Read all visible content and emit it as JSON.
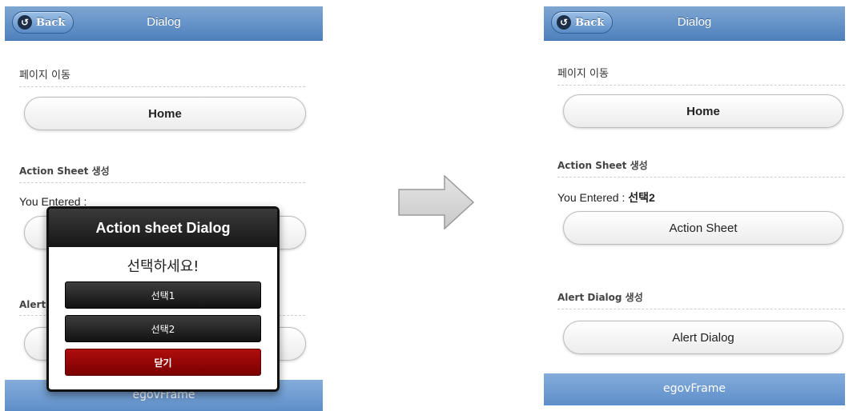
{
  "left_screen": {
    "header": {
      "back_label": "Back",
      "title": "Dialog"
    },
    "sections": {
      "page_nav_label": "페이지 이동",
      "home_button": "Home",
      "action_sheet_label": "Action Sheet 생성",
      "entered_prefix": "You Entered :",
      "alert_label_partial": "Alert"
    },
    "footer": "egovFrame",
    "dialog": {
      "title": "Action sheet Dialog",
      "prompt": "선택하세요!",
      "options": [
        "선택1",
        "선택2"
      ],
      "close_label": "닫기"
    }
  },
  "right_screen": {
    "header": {
      "back_label": "Back",
      "title": "Dialog"
    },
    "sections": {
      "page_nav_label": "페이지 이동",
      "home_button": "Home",
      "action_sheet_label": "Action Sheet 생성",
      "entered_prefix": "You Entered :",
      "entered_value": "선택2",
      "action_sheet_button": "Action Sheet",
      "alert_label": "Alert Dialog 생성",
      "alert_button": "Alert Dialog"
    },
    "footer": "egovFrame"
  },
  "colors": {
    "header_blue": "#4f81bd",
    "footer_blue": "#5c8dc8",
    "dialog_dark": "#161616",
    "close_red": "#9e0b0b"
  }
}
